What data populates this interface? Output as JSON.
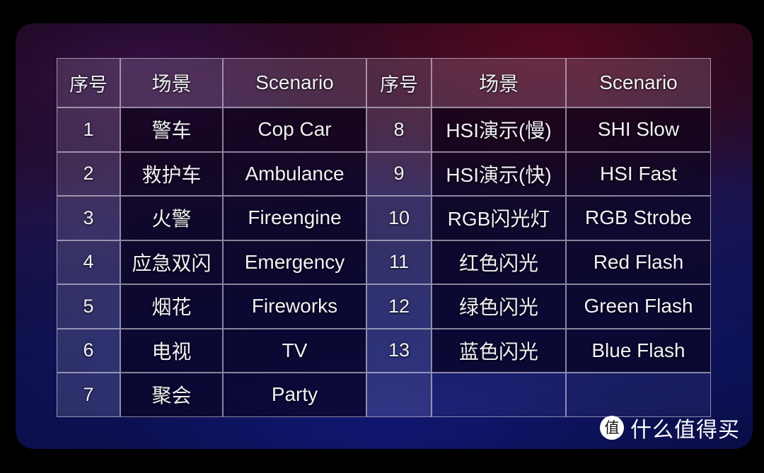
{
  "photo": {
    "colors": {
      "top_left_purple": "#3c124e",
      "top_right_maroon": "#5c0a22",
      "bottom_navy": "#121876",
      "frame_background": "#000000",
      "grid_line": "#d6d0e1",
      "text": "#f2f0f6"
    }
  },
  "table": {
    "headers": [
      "序号",
      "场景",
      "Scenario",
      "序号",
      "场景",
      "Scenario"
    ],
    "rows": [
      {
        "left_index": "1",
        "left_zh": "警车",
        "left_en": "Cop Car",
        "right_index": "8",
        "right_zh": "HSI演示(慢)",
        "right_en": "SHI Slow"
      },
      {
        "left_index": "2",
        "left_zh": "救护车",
        "left_en": "Ambulance",
        "right_index": "9",
        "right_zh": "HSI演示(快)",
        "right_en": "HSI Fast"
      },
      {
        "left_index": "3",
        "left_zh": "火警",
        "left_en": "Fireengine",
        "right_index": "10",
        "right_zh": "RGB闪光灯",
        "right_en": "RGB Strobe"
      },
      {
        "left_index": "4",
        "left_zh": "应急双闪",
        "left_en": "Emergency",
        "right_index": "11",
        "right_zh": "红色闪光",
        "right_en": "Red Flash"
      },
      {
        "left_index": "5",
        "left_zh": "烟花",
        "left_en": "Fireworks",
        "right_index": "12",
        "right_zh": "绿色闪光",
        "right_en": "Green Flash"
      },
      {
        "left_index": "6",
        "left_zh": "电视",
        "left_en": "TV",
        "right_index": "13",
        "right_zh": "蓝色闪光",
        "right_en": "Blue Flash"
      },
      {
        "left_index": "7",
        "left_zh": "聚会",
        "left_en": "Party",
        "right_index": "",
        "right_zh": "",
        "right_en": ""
      }
    ]
  },
  "watermark": {
    "badge_glyph": "值",
    "badge_icon": "zhi-circle-logo-icon",
    "text": "什么值得买"
  }
}
